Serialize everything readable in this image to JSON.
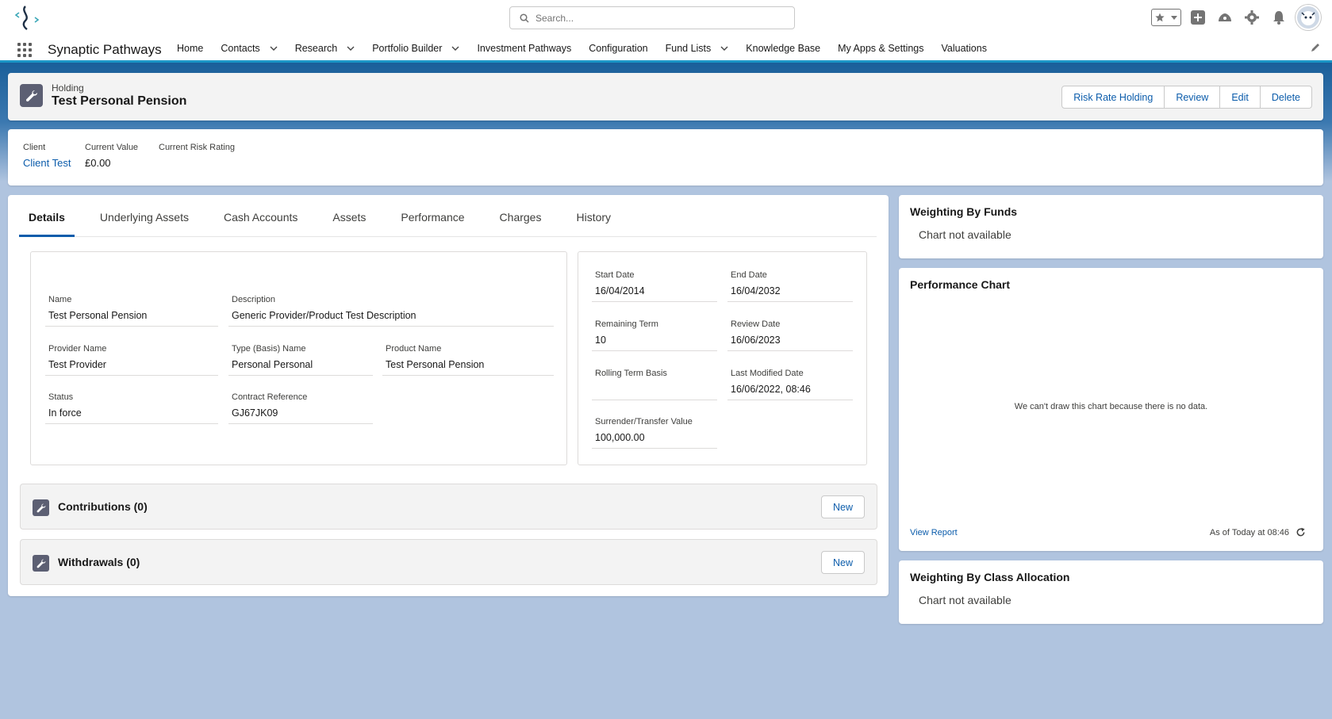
{
  "header": {
    "search_placeholder": "Search...",
    "icons": [
      "favorites-star-icon",
      "dropdown-icon",
      "add-icon",
      "trailhead-icon",
      "setup-gear-icon",
      "notifications-bell-icon",
      "avatar"
    ]
  },
  "nav": {
    "app_name": "Synaptic Pathways",
    "items": [
      {
        "label": "Home",
        "dropdown": false
      },
      {
        "label": "Contacts",
        "dropdown": true
      },
      {
        "label": "Research",
        "dropdown": true
      },
      {
        "label": "Portfolio Builder",
        "dropdown": true
      },
      {
        "label": "Investment Pathways",
        "dropdown": false
      },
      {
        "label": "Configuration",
        "dropdown": false
      },
      {
        "label": "Fund Lists",
        "dropdown": true
      },
      {
        "label": "Knowledge Base",
        "dropdown": false
      },
      {
        "label": "My Apps & Settings",
        "dropdown": false
      },
      {
        "label": "Valuations",
        "dropdown": false
      }
    ]
  },
  "record": {
    "type": "Holding",
    "title": "Test Personal Pension",
    "actions": [
      "Risk Rate Holding",
      "Review",
      "Edit",
      "Delete"
    ]
  },
  "highlights": {
    "client_label": "Client",
    "client_value": "Client Test",
    "current_value_label": "Current Value",
    "current_value": "£0.00",
    "risk_label": "Current Risk Rating",
    "risk_value": ""
  },
  "tabs": [
    "Details",
    "Underlying Assets",
    "Cash Accounts",
    "Assets",
    "Performance",
    "Charges",
    "History"
  ],
  "details_left": {
    "name_label": "Name",
    "name_value": "Test Personal Pension",
    "description_label": "Description",
    "description_value": "Generic Provider/Product Test Description",
    "provider_label": "Provider Name",
    "provider_value": "Test Provider",
    "type_label": "Type (Basis) Name",
    "type_value": "Personal Personal",
    "product_label": "Product Name",
    "product_value": "Test Personal Pension",
    "status_label": "Status",
    "status_value": "In force",
    "contract_label": "Contract Reference",
    "contract_value": "GJ67JK09"
  },
  "details_right": {
    "start_label": "Start Date",
    "start_value": "16/04/2014",
    "end_label": "End Date",
    "end_value": "16/04/2032",
    "remaining_label": "Remaining Term",
    "remaining_value": "10",
    "review_label": "Review Date",
    "review_value": "16/06/2023",
    "rolling_label": "Rolling Term Basis",
    "rolling_value": "",
    "modified_label": "Last Modified Date",
    "modified_value": "16/06/2022, 08:46",
    "surrender_label": "Surrender/Transfer Value",
    "surrender_value": "100,000.00"
  },
  "related": {
    "contributions_title": "Contributions (0)",
    "withdrawals_title": "Withdrawals (0)",
    "new_label": "New"
  },
  "side": {
    "weighting_funds_title": "Weighting By Funds",
    "weighting_funds_text": "Chart not available",
    "performance_title": "Performance Chart",
    "performance_nodata": "We can't draw this chart because there is no data.",
    "view_report": "View Report",
    "as_of": "As of Today at 08:46",
    "weighting_class_title": "Weighting By Class Allocation",
    "weighting_class_text": "Chart not available"
  },
  "colors": {
    "brand_blue": "#0b5cab",
    "nav_accent": "#1b96c7",
    "record_icon_bg": "#5c5f73",
    "page_bg": "#b0c4df"
  }
}
